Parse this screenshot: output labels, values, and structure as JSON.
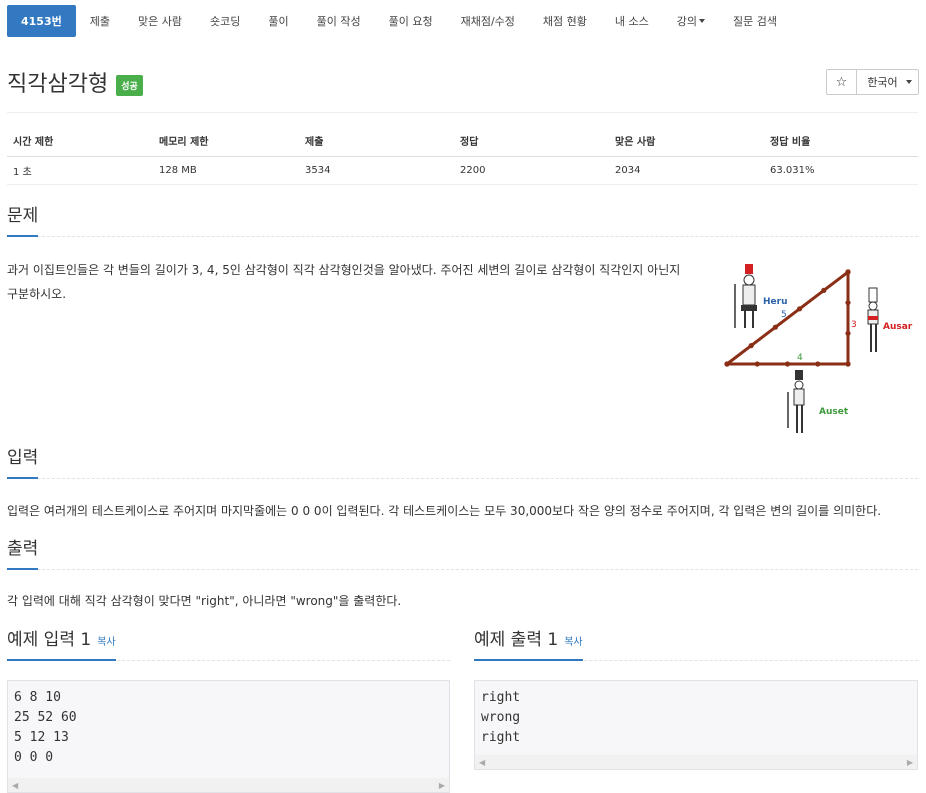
{
  "nav": {
    "tabs": [
      {
        "label": "4153번",
        "active": true
      },
      {
        "label": "제출"
      },
      {
        "label": "맞은 사람"
      },
      {
        "label": "숏코딩"
      },
      {
        "label": "풀이"
      },
      {
        "label": "풀이 작성"
      },
      {
        "label": "풀이 요청"
      },
      {
        "label": "재채점/수정"
      },
      {
        "label": "채점 현황"
      },
      {
        "label": "내 소스"
      },
      {
        "label": "강의",
        "dropdown": true
      },
      {
        "label": "질문 검색"
      }
    ]
  },
  "problem": {
    "title": "직각삼각형",
    "status_badge": "성공",
    "star_icon": "star-icon",
    "language": "한국어"
  },
  "info_table": {
    "headers": [
      "시간 제한",
      "메모리 제한",
      "제출",
      "정답",
      "맞은 사람",
      "정답 비율"
    ],
    "values": [
      "1 초",
      "128 MB",
      "3534",
      "2200",
      "2034",
      "63.031%"
    ]
  },
  "sections": {
    "problem_heading": "문제",
    "problem_text_line1": "과거 이집트인들은 각 변들의 길이가 3, 4, 5인 삼각형이 직각 삼각형인것을 알아냈다. 주어진 세변의 길이로 삼각형이 직각인지 아닌지",
    "problem_text_line2": "구분하시오.",
    "input_heading": "입력",
    "input_text": "입력은 여러개의 테스트케이스로 주어지며 마지막줄에는 0 0 0이 입력된다. 각 테스트케이스는 모두 30,000보다 작은 양의 정수로 주어지며, 각 입력은 변의 길이를 의미한다.",
    "output_heading": "출력",
    "output_text": "각 입력에 대해 직각 삼각형이 맞다면 \"right\", 아니라면 \"wrong\"을 출력한다."
  },
  "figure": {
    "labels": {
      "heru": "Heru",
      "ausar": "Ausar",
      "auset": "Auset",
      "side5": "5",
      "side3": "3",
      "side4": "4"
    },
    "colors": {
      "rope": "#8b2e16",
      "heru": "#2a62a8",
      "ausar": "#d42020",
      "auset": "#3b9a3b"
    }
  },
  "samples": {
    "input_heading": "예제 입력 1",
    "output_heading": "예제 출력 1",
    "copy_label": "복사",
    "input_text": "6 8 10\n25 52 60\n5 12 13\n0 0 0",
    "output_text": "right\nwrong\nright"
  },
  "colors": {
    "accent": "#3279c2",
    "success": "#4aae4a"
  }
}
